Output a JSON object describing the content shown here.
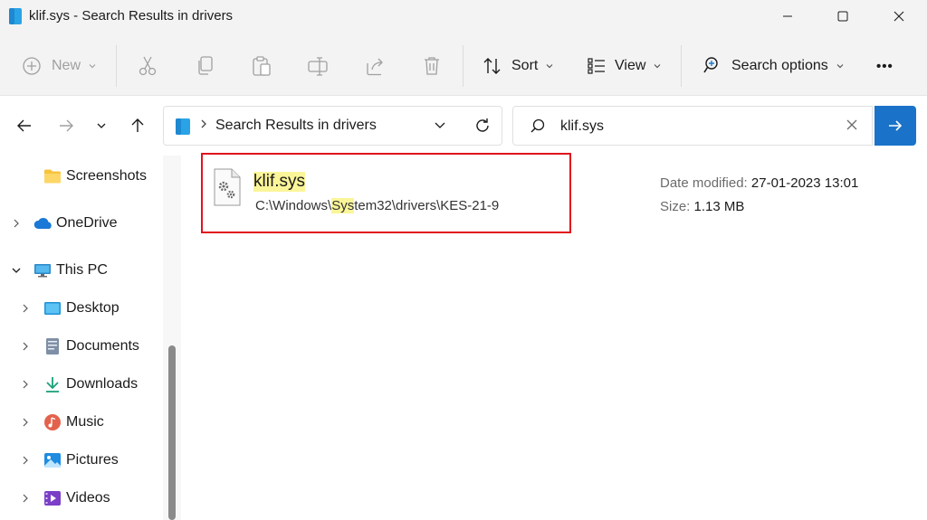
{
  "window": {
    "title": "klif.sys - Search Results in drivers"
  },
  "toolbar": {
    "new_label": "New",
    "sort_label": "Sort",
    "view_label": "View",
    "search_options_label": "Search options",
    "more_label": "•••"
  },
  "address": {
    "crumb": "Search Results in drivers"
  },
  "search": {
    "value": "klif.sys"
  },
  "sidebar": {
    "items": [
      {
        "label": "Screenshots",
        "icon": "folder-icon"
      },
      {
        "label": "OneDrive",
        "icon": "onedrive-icon"
      },
      {
        "label": "This PC",
        "icon": "monitor-icon"
      },
      {
        "label": "Desktop",
        "icon": "desktop-icon"
      },
      {
        "label": "Documents",
        "icon": "documents-icon"
      },
      {
        "label": "Downloads",
        "icon": "downloads-icon"
      },
      {
        "label": "Music",
        "icon": "music-icon"
      },
      {
        "label": "Pictures",
        "icon": "pictures-icon"
      },
      {
        "label": "Videos",
        "icon": "videos-icon"
      }
    ]
  },
  "results": [
    {
      "name": "klif.sys",
      "path_prefix": "C:\\Windows\\",
      "path_highlight": "Sys",
      "path_suffix": "tem32\\drivers\\KES-21-9",
      "date_label": "Date modified:",
      "date_value": "27-01-2023 13:01",
      "size_label": "Size:",
      "size_value": "1.13 MB"
    }
  ],
  "colors": {
    "accent": "#1a73c9",
    "highlight": "#fbf599",
    "annotation_box": "#e0141e"
  }
}
